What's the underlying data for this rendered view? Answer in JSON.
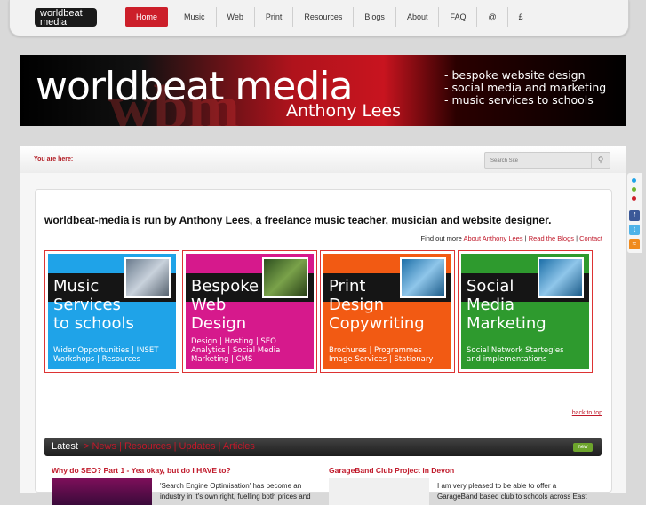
{
  "brand": {
    "small_line1": "worldbeat",
    "small_line2": "media"
  },
  "nav": {
    "items": [
      {
        "label": "Home",
        "active": true
      },
      {
        "label": "Music"
      },
      {
        "label": "Web"
      },
      {
        "label": "Print"
      },
      {
        "label": "Resources"
      },
      {
        "label": "Blogs"
      },
      {
        "label": "About"
      },
      {
        "label": "FAQ"
      },
      {
        "label": "@"
      },
      {
        "label": "£"
      }
    ]
  },
  "banner": {
    "brand": "worldbeat media",
    "subtitle": "Anthony Lees",
    "services": [
      "- bespoke website design",
      "- social media and marketing",
      "- music services to schools"
    ]
  },
  "breadcrumb": {
    "label": "You are here:"
  },
  "search": {
    "placeholder": "Search Site"
  },
  "intro": {
    "text": "worldbeat-media is run by Anthony Lees, a freelance music teacher, musician and website designer."
  },
  "findmore": {
    "prefix": "Find out more",
    "links": [
      "About Anthony Lees",
      "Read the Blogs",
      "Contact"
    ]
  },
  "tiles": [
    {
      "title": "Music\nServices\nto schools",
      "desc": "Wider Opportunities | INSET\nWorkshops | Resources",
      "color": "#1fa3e8"
    },
    {
      "title": "Bespoke\nWeb\nDesign",
      "desc": "Design | Hosting | SEO\nAnalytics | Social Media\nMarketing | CMS",
      "color": "#d6198c"
    },
    {
      "title": "Print\nDesign\nCopywriting",
      "desc": "Brochures | Programmes\nImage Services | Stationary",
      "color": "#f25a13"
    },
    {
      "title": "Social\nMedia\nMarketing",
      "desc": "Social Network Startegies\nand implementations",
      "color": "#2e9a2e"
    }
  ],
  "back_to_top": "back to top",
  "latest": {
    "label": "Latest",
    "links": "> News | Resources | Updates | Articles",
    "badge": "new"
  },
  "posts": [
    {
      "title": "Why do SEO? Part 1 - Yea okay, but do I HAVE to?",
      "excerpt": "'Search Engine Optimisation' has become an industry in it's own right, fuelling both prices and"
    },
    {
      "title": "GarageBand Club Project in Devon",
      "excerpt": "I am very pleased to be able to offer a GarageBand based club to schools across East"
    }
  ],
  "colors": {
    "accent": "#cc1f2a",
    "link": "#c0192a"
  },
  "social_icons": [
    "facebook-icon",
    "twitter-icon",
    "rss-icon"
  ]
}
